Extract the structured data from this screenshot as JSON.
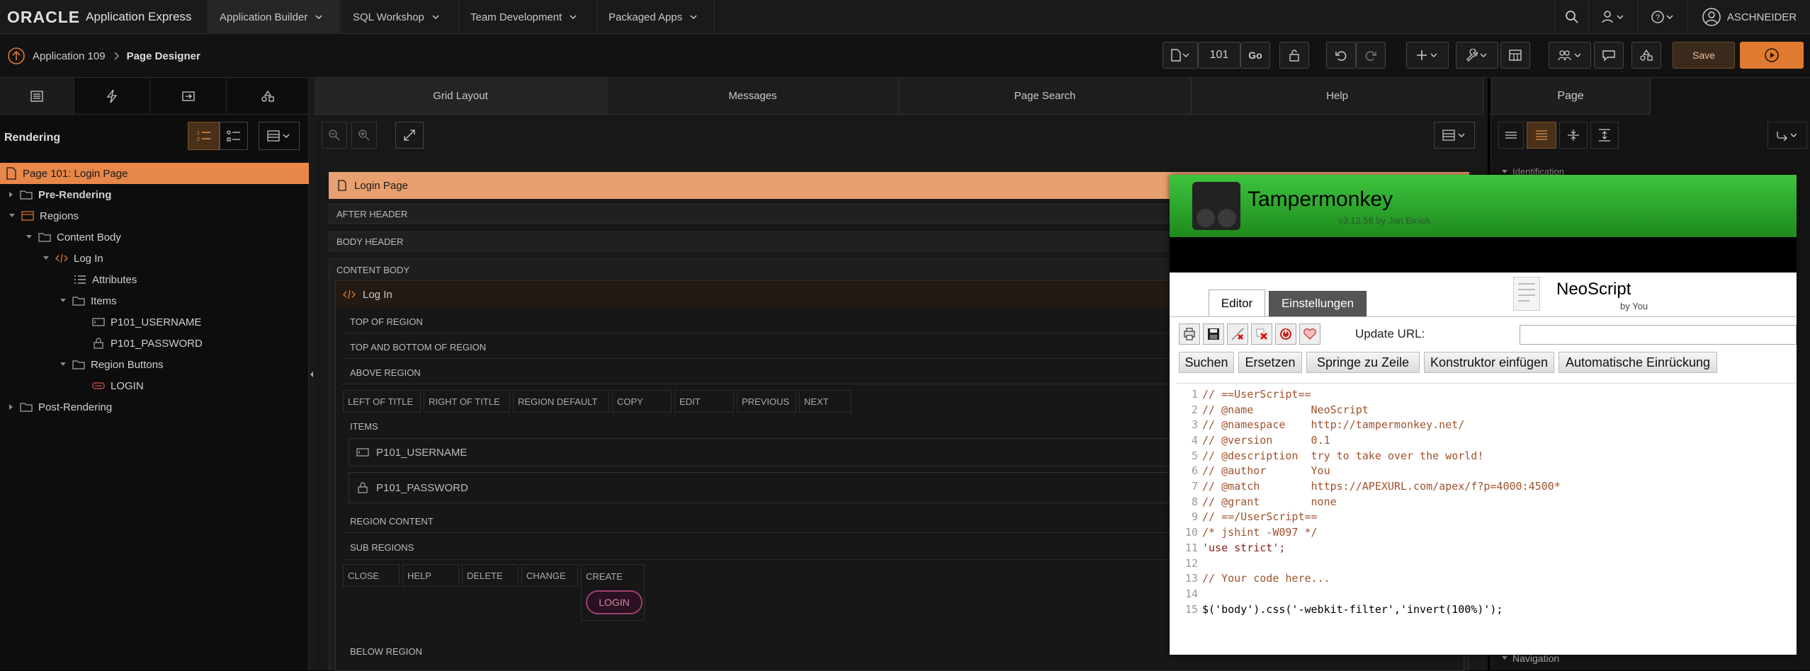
{
  "topbar": {
    "brand_oracle": "ORACLE",
    "brand_apex": "Application Express",
    "tabs": [
      {
        "label": "Application Builder"
      },
      {
        "label": "SQL Workshop"
      },
      {
        "label": "Team Development"
      },
      {
        "label": "Packaged Apps"
      }
    ],
    "user": "ASCHNEIDER"
  },
  "breadcrumb": {
    "app": "Application 109",
    "page": "Page Designer"
  },
  "toolbar": {
    "page_number": "101",
    "go_label": "Go",
    "save_label": "Save"
  },
  "left": {
    "rendering_label": "Rendering",
    "tree": [
      {
        "label": "Page 101: Login Page"
      },
      {
        "label": "Pre-Rendering"
      },
      {
        "label": "Regions"
      },
      {
        "label": "Content Body"
      },
      {
        "label": "Log In"
      },
      {
        "label": "Attributes"
      },
      {
        "label": "Items"
      },
      {
        "label": "P101_USERNAME"
      },
      {
        "label": "P101_PASSWORD"
      },
      {
        "label": "Region Buttons"
      },
      {
        "label": "LOGIN"
      },
      {
        "label": "Post-Rendering"
      }
    ]
  },
  "middle": {
    "tabs": [
      {
        "label": "Grid Layout"
      },
      {
        "label": "Messages"
      },
      {
        "label": "Page Search"
      },
      {
        "label": "Help"
      }
    ],
    "page_title": "Login Page",
    "after_header": "AFTER HEADER",
    "body_header": "BODY HEADER",
    "content_body": "CONTENT BODY",
    "region_title": "Log In",
    "top_of_region": "TOP OF REGION",
    "top_bottom_region": "TOP AND BOTTOM OF REGION",
    "above_region": "ABOVE REGION",
    "slots1": [
      "LEFT OF TITLE",
      "RIGHT OF TITLE",
      "REGION DEFAULT",
      "COPY",
      "EDIT",
      "PREVIOUS",
      "NEXT"
    ],
    "items_label": "ITEMS",
    "item_username": "P101_USERNAME",
    "item_password": "P101_PASSWORD",
    "region_content": "REGION CONTENT",
    "sub_regions": "SUB REGIONS",
    "slots2": [
      "CLOSE",
      "HELP",
      "DELETE",
      "CHANGE",
      "CREATE"
    ],
    "login_button": "LOGIN",
    "below_region": "BELOW REGION"
  },
  "right": {
    "tab_page": "Page",
    "identification": "Identification",
    "navigation": "Navigation"
  },
  "tampermonkey": {
    "title": "Tampermonkey",
    "version": "v3.12.58 by Jan Biniok",
    "tab_editor": "Editor",
    "tab_settings": "Einstellungen",
    "script_name": "NeoScript",
    "script_by": "by You",
    "update_url_label": "Update URL:",
    "buttons": [
      "Suchen",
      "Ersetzen",
      "Springe zu Zeile",
      "Konstruktor einfügen",
      "Automatische Einrückung"
    ],
    "code_lines": [
      {
        "n": "1",
        "t": "// ==UserScript==",
        "k": "c"
      },
      {
        "n": "2",
        "t": "// @name         NeoScript",
        "k": "c"
      },
      {
        "n": "3",
        "t": "// @namespace    http://tampermonkey.net/",
        "k": "c"
      },
      {
        "n": "4",
        "t": "// @version      0.1",
        "k": "c"
      },
      {
        "n": "5",
        "t": "// @description  try to take over the world!",
        "k": "c"
      },
      {
        "n": "6",
        "t": "// @author       You",
        "k": "c"
      },
      {
        "n": "7",
        "t": "// @match        https://APEXURL.com/apex/f?p=4000:4500*",
        "k": "c"
      },
      {
        "n": "8",
        "t": "// @grant        none",
        "k": "c"
      },
      {
        "n": "9",
        "t": "// ==/UserScript==",
        "k": "c"
      },
      {
        "n": "10",
        "t": "/* jshint -W097 */",
        "k": "c"
      },
      {
        "n": "11",
        "t": "'use strict';",
        "k": "s"
      },
      {
        "n": "12",
        "t": "",
        "k": "c"
      },
      {
        "n": "13",
        "t": "// Your code here...",
        "k": "c"
      },
      {
        "n": "14",
        "t": "",
        "k": "c"
      },
      {
        "n": "15",
        "t": "$('body').css('-webkit-filter','invert(100%)');",
        "k": "x"
      }
    ]
  }
}
